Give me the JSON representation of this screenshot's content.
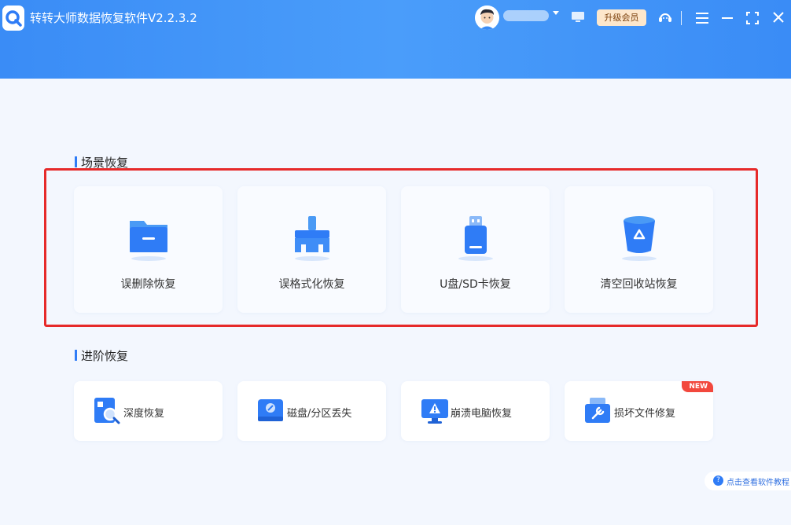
{
  "app": {
    "title": "转转大师数据恢复软件V2.2.3.2"
  },
  "header": {
    "username": "•••••",
    "upgrade_label": "升级会员"
  },
  "sections": {
    "scene": {
      "title": "场景恢复",
      "items": [
        {
          "label": "误删除恢复",
          "icon": "folder-icon"
        },
        {
          "label": "误格式化恢复",
          "icon": "broom-icon"
        },
        {
          "label": "U盘/SD卡恢复",
          "icon": "usb-drive-icon"
        },
        {
          "label": "清空回收站恢复",
          "icon": "recycle-bin-icon"
        }
      ]
    },
    "advanced": {
      "title": "进阶恢复",
      "items": [
        {
          "label": "深度恢复",
          "icon": "deep-scan-icon"
        },
        {
          "label": "磁盘/分区丢失",
          "icon": "disk-icon"
        },
        {
          "label": "崩溃电脑恢复",
          "icon": "crashed-computer-icon"
        },
        {
          "label": "损坏文件修复",
          "icon": "file-repair-icon",
          "badge": "NEW"
        }
      ]
    }
  },
  "tutorial": {
    "label": "点击查看软件教程"
  },
  "colors": {
    "header": "#3a8cf6",
    "accent": "#2f7cf6",
    "highlight": "#e62a2a",
    "vip_bg": "#fde7cc",
    "badge": "#f2483d"
  }
}
